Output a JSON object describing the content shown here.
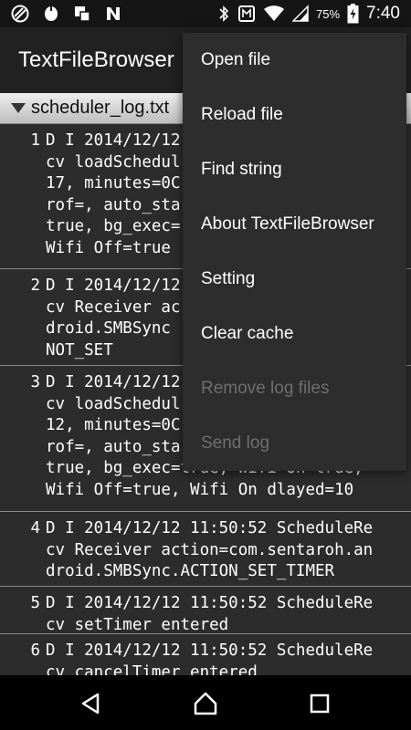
{
  "status_bar": {
    "battery_percent": "75%",
    "time": "7:40",
    "icons": [
      "app-icon",
      "app-icon-2",
      "app-icon-3",
      "app-icon-4",
      "bluetooth-icon",
      "nfc-icon",
      "wifi-icon",
      "cellular-signal-icon",
      "battery-icon"
    ]
  },
  "app_bar": {
    "title": "TextFileBrowser"
  },
  "file_header": {
    "filename": "scheduler_log.txt"
  },
  "log_entries": [
    {
      "num": "1",
      "text": "D I 2014/12/12\ncv loadSchedul\n17, minutes=0C\nrof=, auto_sta\ntrue, bg_exec=\nWifi Off=true"
    },
    {
      "num": "2",
      "text": "D I 2014/12/12\ncv Receiver ac\ndroid.SMBSync\nNOT_SET"
    },
    {
      "num": "3",
      "text": "D I 2014/12/12\ncv loadSchedul\n12, minutes=0C\nrof=, auto_sta\ntrue, bg_exec=true, Wifi On=true,\nWifi Off=true, Wifi On dlayed=10"
    },
    {
      "num": "4",
      "text": "D I 2014/12/12 11:50:52 ScheduleRe\ncv Receiver action=com.sentaroh.an\ndroid.SMBSync.ACTION_SET_TIMER"
    },
    {
      "num": "5",
      "text": "D I 2014/12/12 11:50:52 ScheduleRe\ncv setTimer entered"
    },
    {
      "num": "6",
      "text": "D I 2014/12/12 11:50:52 ScheduleRe\ncv cancelTimer entered"
    }
  ],
  "menu": {
    "items": [
      {
        "label": "Open file",
        "enabled": true
      },
      {
        "label": "Reload file",
        "enabled": true
      },
      {
        "label": "Find string",
        "enabled": true
      },
      {
        "label": "About TextFileBrowser",
        "enabled": true
      },
      {
        "label": "Setting",
        "enabled": true
      },
      {
        "label": "Clear cache",
        "enabled": true
      },
      {
        "label": "Remove log files",
        "enabled": false
      },
      {
        "label": "Send log",
        "enabled": false
      }
    ]
  },
  "nav_bar": {
    "icons": [
      "back-icon",
      "home-icon",
      "recents-icon"
    ]
  },
  "colors": {
    "status_bar": "#151515",
    "app_bar": "#212121",
    "log_background": "#2c2c2c",
    "menu_background": "#2d2d2d",
    "disabled_text": "#6e6e6e"
  }
}
